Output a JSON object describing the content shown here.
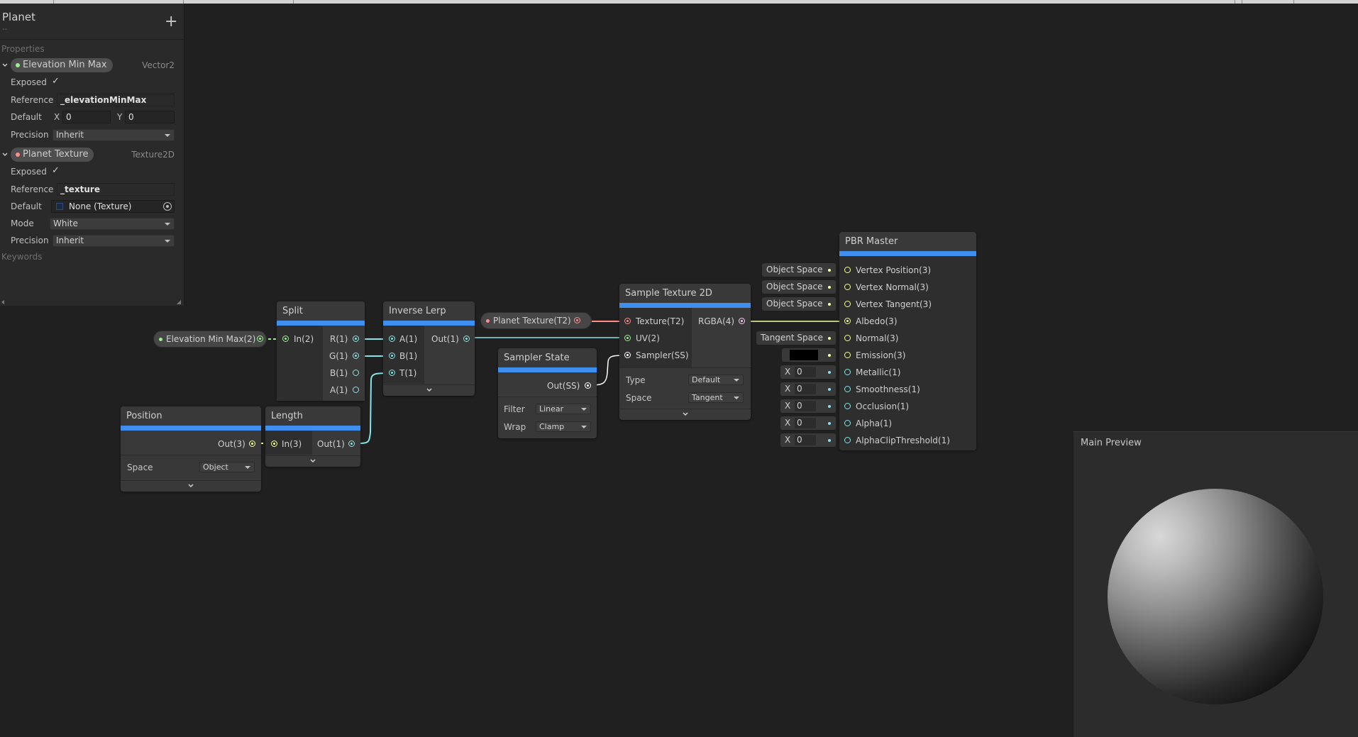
{
  "blackboard": {
    "title": "Planet",
    "subtitle": "--",
    "add_label": "+",
    "properties_header": "Properties",
    "keywords_header": "Keywords",
    "properties": [
      {
        "name": "Elevation Min Max",
        "type": "Vector2",
        "exposed_label": "Exposed",
        "exposed_value": "✓",
        "reference_label": "Reference",
        "reference_value": "_elevationMinMax",
        "default_label": "Default",
        "default_x_label": "X",
        "default_x": "0",
        "default_y_label": "Y",
        "default_y": "0",
        "precision_label": "Precision",
        "precision_value": "Inherit"
      },
      {
        "name": "Planet Texture",
        "type": "Texture2D",
        "exposed_label": "Exposed",
        "exposed_value": "✓",
        "reference_label": "Reference",
        "reference_value": "_texture",
        "default_label": "Default",
        "default_value": "None (Texture)",
        "mode_label": "Mode",
        "mode_value": "White",
        "precision_label": "Precision",
        "precision_value": "Inherit"
      }
    ]
  },
  "nodes": {
    "elevation_prop": {
      "label": "Elevation Min Max(2)"
    },
    "planet_tex_prop": {
      "label": "Planet Texture(T2)"
    },
    "split": {
      "title": "Split",
      "inputs": [
        "In(2)"
      ],
      "outputs": [
        "R(1)",
        "G(1)",
        "B(1)",
        "A(1)"
      ]
    },
    "inverse_lerp": {
      "title": "Inverse Lerp",
      "inputs": [
        "A(1)",
        "B(1)",
        "T(1)"
      ],
      "outputs": [
        "Out(1)"
      ]
    },
    "position": {
      "title": "Position",
      "outputs": [
        "Out(3)"
      ],
      "space_label": "Space",
      "space_value": "Object"
    },
    "length": {
      "title": "Length",
      "inputs": [
        "In(3)"
      ],
      "outputs": [
        "Out(1)"
      ]
    },
    "sampler_state": {
      "title": "Sampler State",
      "outputs": [
        "Out(SS)"
      ],
      "filter_label": "Filter",
      "filter_value": "Linear",
      "wrap_label": "Wrap",
      "wrap_value": "Clamp"
    },
    "sample_texture": {
      "title": "Sample Texture 2D",
      "inputs": [
        "Texture(T2)",
        "UV(2)",
        "Sampler(SS)"
      ],
      "outputs": [
        "RGBA(4)"
      ],
      "type_label": "Type",
      "type_value": "Default",
      "space_label": "Space",
      "space_value": "Tangent"
    },
    "pbr_master": {
      "title": "PBR Master",
      "inputs": [
        "Vertex Position(3)",
        "Vertex Normal(3)",
        "Vertex Tangent(3)",
        "Albedo(3)",
        "Normal(3)",
        "Emission(3)",
        "Metallic(1)",
        "Smoothness(1)",
        "Occlusion(1)",
        "Alpha(1)",
        "AlphaClipThreshold(1)"
      ],
      "inline_inputs": {
        "vertex_position": "Object Space",
        "vertex_normal": "Object Space",
        "vertex_tangent": "Object Space",
        "normal": "Tangent Space",
        "x_label": "X",
        "metallic": "0",
        "smoothness": "0",
        "occlusion": "0",
        "alpha": "0",
        "alpha_clip": "0"
      }
    }
  },
  "preview": {
    "title": "Main Preview"
  },
  "colors": {
    "node_accent": "#3f8ff0",
    "float_port": "#84e4e7",
    "vector2_port": "#9aef92",
    "vector3_port": "#f6ff9a",
    "vector4_port": "#fbcbf4",
    "texture_port": "#ff8b8b",
    "sampler_port": "#ffffff",
    "background": "#202020"
  }
}
